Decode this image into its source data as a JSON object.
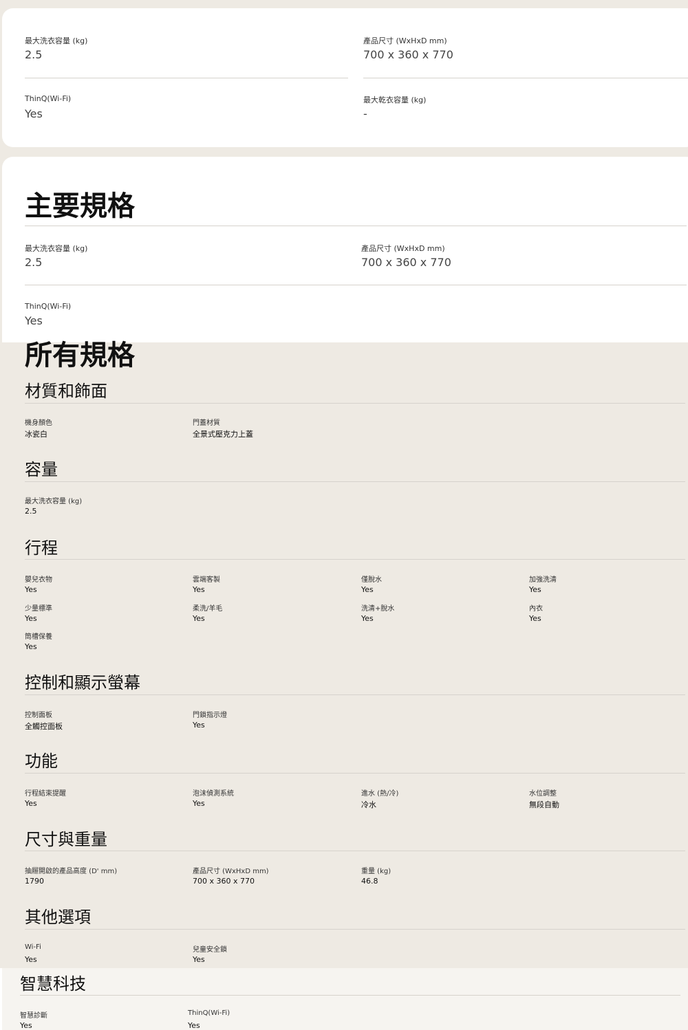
{
  "top_card": {
    "items": [
      {
        "label": "最大洗衣容量 (kg)",
        "value": "2.5"
      },
      {
        "label": "產品尺寸 (WxHxD mm)",
        "value": "700 x 360 x 770"
      },
      {
        "label": "ThinQ(Wi-Fi)",
        "value": "Yes"
      },
      {
        "label": "最大乾衣容量 (kg)",
        "value": "-"
      }
    ]
  },
  "key_specs": {
    "title": "主要規格",
    "items": [
      {
        "label": "最大洗衣容量 (kg)",
        "value": "2.5"
      },
      {
        "label": "產品尺寸 (WxHxD mm)",
        "value": "700 x 360 x 770"
      },
      {
        "label": "ThinQ(Wi-Fi)",
        "value": "Yes"
      }
    ]
  },
  "all_specs": {
    "title": "所有規格",
    "sections": [
      {
        "title": "材質和飾面",
        "items": [
          {
            "label": "機身顏色",
            "value": "冰瓷白"
          },
          {
            "label": "門蓋材質",
            "value": "全景式壓克力上蓋"
          }
        ]
      },
      {
        "title": "容量",
        "items": [
          {
            "label": "最大洗衣容量 (kg)",
            "value": "2.5"
          }
        ]
      },
      {
        "title": "行程",
        "items": [
          {
            "label": "嬰兒衣物",
            "value": "Yes"
          },
          {
            "label": "雲端客製",
            "value": "Yes"
          },
          {
            "label": "僅脫水",
            "value": "Yes"
          },
          {
            "label": "加強洗清",
            "value": "Yes"
          },
          {
            "label": "少量標準",
            "value": "Yes"
          },
          {
            "label": "柔洗/羊毛",
            "value": "Yes"
          },
          {
            "label": "洗清+脫水",
            "value": "Yes"
          },
          {
            "label": "內衣",
            "value": "Yes"
          },
          {
            "label": "筒槽保養",
            "value": "Yes"
          }
        ]
      },
      {
        "title": "控制和顯示螢幕",
        "items": [
          {
            "label": "控制面板",
            "value": "全觸控面板"
          },
          {
            "label": "門鎖指示燈",
            "value": "Yes"
          }
        ]
      },
      {
        "title": "功能",
        "items": [
          {
            "label": "行程結束提醒",
            "value": "Yes"
          },
          {
            "label": "泡沫偵測系統",
            "value": "Yes"
          },
          {
            "label": "進水 (熱/冷)",
            "value": "冷水"
          },
          {
            "label": "水位調整",
            "value": "無段自動"
          }
        ]
      },
      {
        "title": "尺寸與重量",
        "items": [
          {
            "label": "抽屜開啟的產品高度 (D' mm)",
            "value": "1790"
          },
          {
            "label": "產品尺寸 (WxHxD mm)",
            "value": "700 x 360 x 770"
          },
          {
            "label": "重量 (kg)",
            "value": "46.8"
          }
        ]
      },
      {
        "title": "其他選項",
        "items": [
          {
            "label": "Wi-Fi",
            "value": "Yes"
          },
          {
            "label": "兒童安全鎖",
            "value": "Yes"
          }
        ]
      },
      {
        "title": "智慧科技",
        "items": [
          {
            "label": "智慧診斷",
            "value": "Yes"
          },
          {
            "label": "ThinQ(Wi-Fi)",
            "value": "Yes"
          }
        ]
      }
    ]
  }
}
